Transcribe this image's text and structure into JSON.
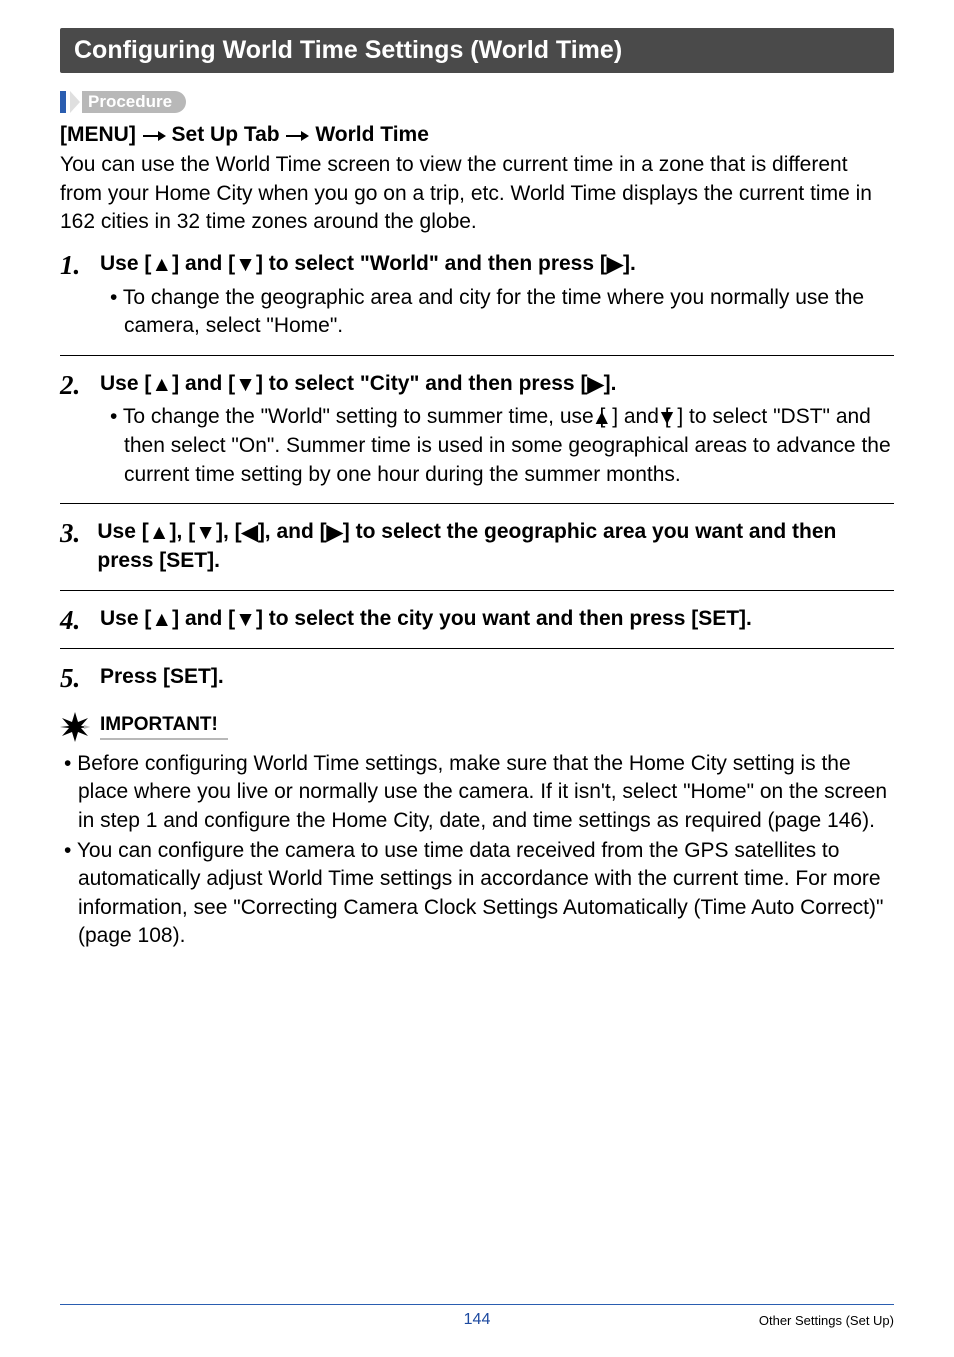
{
  "title": "Configuring World Time Settings (World Time)",
  "procedure_label": "Procedure",
  "breadcrumb": {
    "menu": "[MENU]",
    "tab": "Set Up Tab",
    "item": "World Time"
  },
  "intro": "You can use the World Time screen to view the current time in a zone that is different from your Home City when you go on a trip, etc. World Time displays the current time in 162 cities in 32 time zones around the globe.",
  "steps": [
    {
      "num": "1.",
      "title_pre": "Use [",
      "title_mid1": "] and [",
      "title_mid2": "] to select \"World\" and then press [",
      "title_end": "].",
      "bullets": [
        "To change the geographic area and city for the time where you normally use the camera, select \"Home\"."
      ]
    },
    {
      "num": "2.",
      "title_pre": "Use [",
      "title_mid1": "] and [",
      "title_mid2": "] to select \"City\" and then press [",
      "title_end": "].",
      "bullets_pre": "To change the \"World\" setting to summer time, use [",
      "bullets_mid": "] and [",
      "bullets_post": "] to select \"DST\" and then select \"On\". Summer time is used in some geographical areas to advance the current time setting by one hour during the summer months."
    },
    {
      "num": "3.",
      "title_pre": "Use [",
      "title_seg1": "], [",
      "title_seg2": "], [",
      "title_seg3": "], and [",
      "title_end": "] to select the geographic area you want and then press [SET]."
    },
    {
      "num": "4.",
      "title_pre": "Use [",
      "title_mid1": "] and [",
      "title_end": "] to select the city you want and then press [SET]."
    },
    {
      "num": "5.",
      "title": "Press [SET]."
    }
  ],
  "important_label": "IMPORTANT!",
  "important_bullets": [
    "Before configuring World Time settings, make sure that the Home City setting is the place where you live or normally use the camera. If it isn't, select \"Home\" on the screen in step 1 and configure the Home City, date, and time settings as required (page 146).",
    "You can configure the camera to use time data received from the GPS satellites to automatically adjust World Time settings in accordance with the current time. For more information, see \"Correcting Camera Clock Settings Automatically (Time Auto Correct)\" (page 108)."
  ],
  "page_number": "144",
  "footer_right": "Other Settings (Set Up)"
}
